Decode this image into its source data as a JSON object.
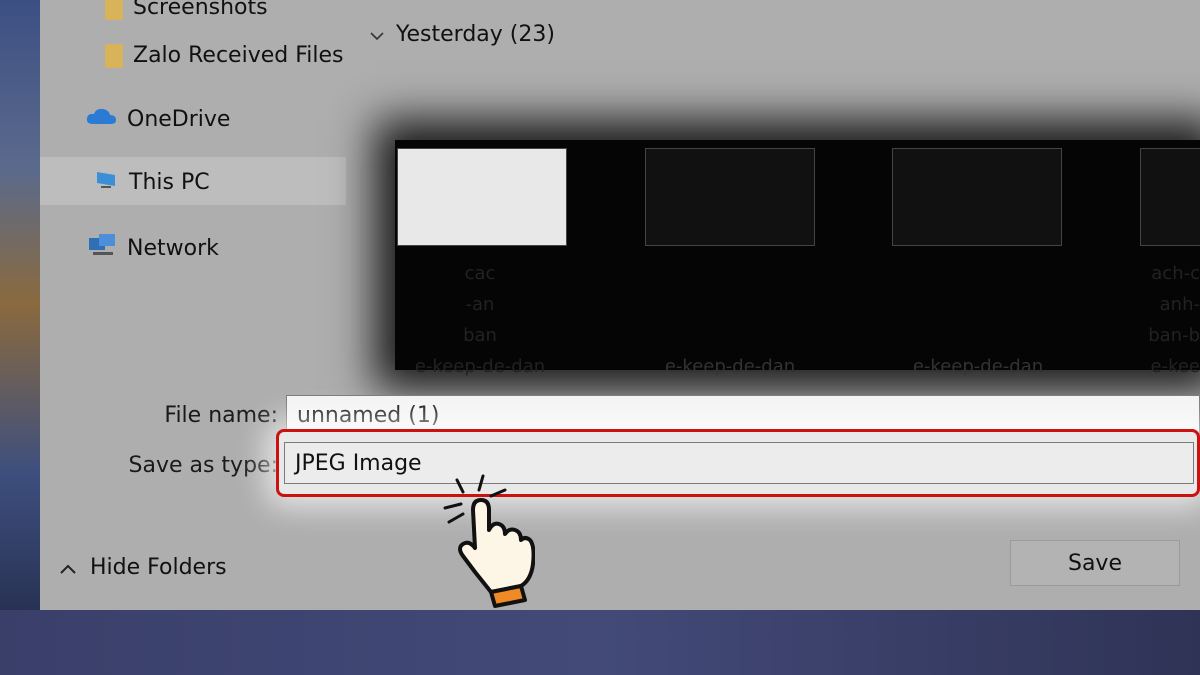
{
  "sidebar": {
    "items": [
      {
        "label": "Screenshots",
        "icon": "folder-icon"
      },
      {
        "label": "Zalo Received Files",
        "icon": "folder-icon"
      },
      {
        "label": "OneDrive",
        "icon": "onedrive-icon"
      },
      {
        "label": "This PC",
        "icon": "pc-icon",
        "selected": true
      },
      {
        "label": "Network",
        "icon": "network-icon"
      }
    ]
  },
  "content": {
    "group_header": "Yesterday (23)",
    "thumbnails": [
      {
        "caption": [
          "cac",
          "-an",
          "ban",
          "e-keep-de-dan"
        ]
      },
      {
        "caption": [
          "",
          "",
          "",
          "e-keep-de-dan"
        ]
      },
      {
        "caption": [
          "",
          "",
          "",
          "e-keep-de-dan"
        ]
      },
      {
        "caption": [
          "ach-c",
          "anh-",
          "ban-b",
          "e-kee"
        ]
      }
    ]
  },
  "form": {
    "file_name_label": "File name:",
    "file_name_value": "unnamed (1)",
    "save_type_label": "Save as type:",
    "save_type_value": "JPEG Image"
  },
  "footer": {
    "hide_folders_label": "Hide Folders",
    "save_label": "Save"
  },
  "colors": {
    "highlight": "#cc1111",
    "folder": "#d9b35a",
    "onedrive": "#2a7bd4"
  }
}
